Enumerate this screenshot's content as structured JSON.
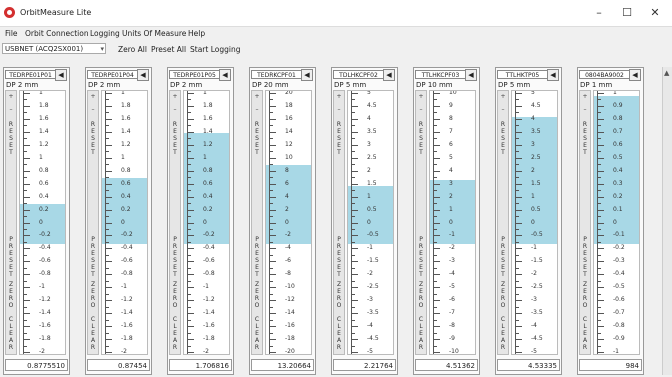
{
  "window": {
    "title": "OrbitMeasure Lite",
    "minimize": "–",
    "maximize": "☐",
    "close": "✕"
  },
  "menu": [
    "File",
    "Orbit Connection",
    "Logging",
    "Units Of Measure",
    "Help"
  ],
  "toolbar": {
    "device": "USBNET (ACQ2SX001)",
    "zero_all": "Zero All",
    "preset_all": "Preset All",
    "start_logging": "Start Logging"
  },
  "strip": {
    "top": "RESET",
    "bottom": "PRESET",
    "zero": "ZERO",
    "clear": "CLEAR"
  },
  "colors": {
    "fill": "#a8d8e6",
    "accent": "#d32f2f"
  },
  "gauges": [
    {
      "sensor": "TEDRPE01P01",
      "resolution": "DP  2 mm",
      "value": "0.8775510",
      "fill_from": 0.43,
      "fill_to": 0.58,
      "labels": [
        "1",
        "1.8",
        "1.6",
        "1.4",
        "1.2",
        "1",
        "0.8",
        "0.6",
        "0.4",
        "0.2",
        "0",
        "-0.2",
        "-0.4",
        "-0.6",
        "-0.8",
        "-1",
        "-1.2",
        "-1.4",
        "-1.6",
        "-1.8",
        "-2"
      ]
    },
    {
      "sensor": "TEDRPE01P04",
      "resolution": "DP  2 mm",
      "value": "0.87454",
      "fill_from": 0.33,
      "fill_to": 0.58,
      "labels": [
        "1",
        "1.8",
        "1.6",
        "1.4",
        "1.2",
        "1",
        "0.8",
        "0.6",
        "0.4",
        "0.2",
        "0",
        "-0.2",
        "-0.4",
        "-0.6",
        "-0.8",
        "-1",
        "-1.2",
        "-1.4",
        "-1.6",
        "-1.8",
        "-2"
      ]
    },
    {
      "sensor": "TEDRPE01P05",
      "resolution": "DP  2 mm",
      "value": "1.706816",
      "fill_from": 0.16,
      "fill_to": 0.58,
      "labels": [
        "1",
        "1.8",
        "1.6",
        "1.4",
        "1.2",
        "1",
        "0.8",
        "0.6",
        "0.4",
        "0.2",
        "0",
        "-0.2",
        "-0.4",
        "-0.6",
        "-0.8",
        "-1",
        "-1.2",
        "-1.4",
        "-1.6",
        "-1.8",
        "-2"
      ]
    },
    {
      "sensor": "TEDRKCPF01",
      "resolution": "DP  20 mm",
      "value": "13.20664",
      "fill_from": 0.28,
      "fill_to": 0.58,
      "labels": [
        "20",
        "18",
        "16",
        "14",
        "12",
        "10",
        "8",
        "6",
        "4",
        "2",
        "0",
        "-2",
        "-4",
        "-6",
        "-8",
        "-10",
        "-12",
        "-14",
        "-16",
        "-18",
        "-20"
      ]
    },
    {
      "sensor": "TDLHKCPF02",
      "resolution": "DP  5 mm",
      "value": "2.21764",
      "fill_from": 0.36,
      "fill_to": 0.58,
      "labels": [
        "5",
        "4.5",
        "4",
        "3.5",
        "3",
        "2.5",
        "2",
        "1.5",
        "1",
        "0.5",
        "0",
        "-0.5",
        "-1",
        "-1.5",
        "-2",
        "-2.5",
        "-3",
        "-3.5",
        "-4",
        "-4.5",
        "-5"
      ]
    },
    {
      "sensor": "TTLHKCPF03",
      "resolution": "DP  10 mm",
      "value": "4.51362",
      "fill_from": 0.34,
      "fill_to": 0.58,
      "labels": [
        "10",
        "9",
        "8",
        "7",
        "6",
        "5",
        "4",
        "3",
        "2",
        "1",
        "0",
        "-1",
        "-2",
        "-3",
        "-4",
        "-5",
        "-6",
        "-7",
        "-8",
        "-9",
        "-10"
      ]
    },
    {
      "sensor": "TTLHKTP05",
      "resolution": "DP  5 mm",
      "value": "4.53335",
      "fill_from": 0.1,
      "fill_to": 0.58,
      "labels": [
        "5",
        "4.5",
        "4",
        "3.5",
        "3",
        "2.5",
        "2",
        "1.5",
        "1",
        "0.5",
        "0",
        "-0.5",
        "-1",
        "-1.5",
        "-2",
        "-2.5",
        "-3",
        "-3.5",
        "-4",
        "-4.5",
        "-5"
      ]
    },
    {
      "sensor": "0804BA9002",
      "resolution": "DP  1 mm",
      "value": "984",
      "fill_from": 0.02,
      "fill_to": 0.58,
      "labels": [
        "1",
        "0.9",
        "0.8",
        "0.7",
        "0.6",
        "0.5",
        "0.4",
        "0.3",
        "0.2",
        "0.1",
        "0",
        "-0.1",
        "-0.2",
        "-0.3",
        "-0.4",
        "-0.5",
        "-0.6",
        "-0.7",
        "-0.8",
        "-0.9",
        "-1"
      ]
    }
  ]
}
